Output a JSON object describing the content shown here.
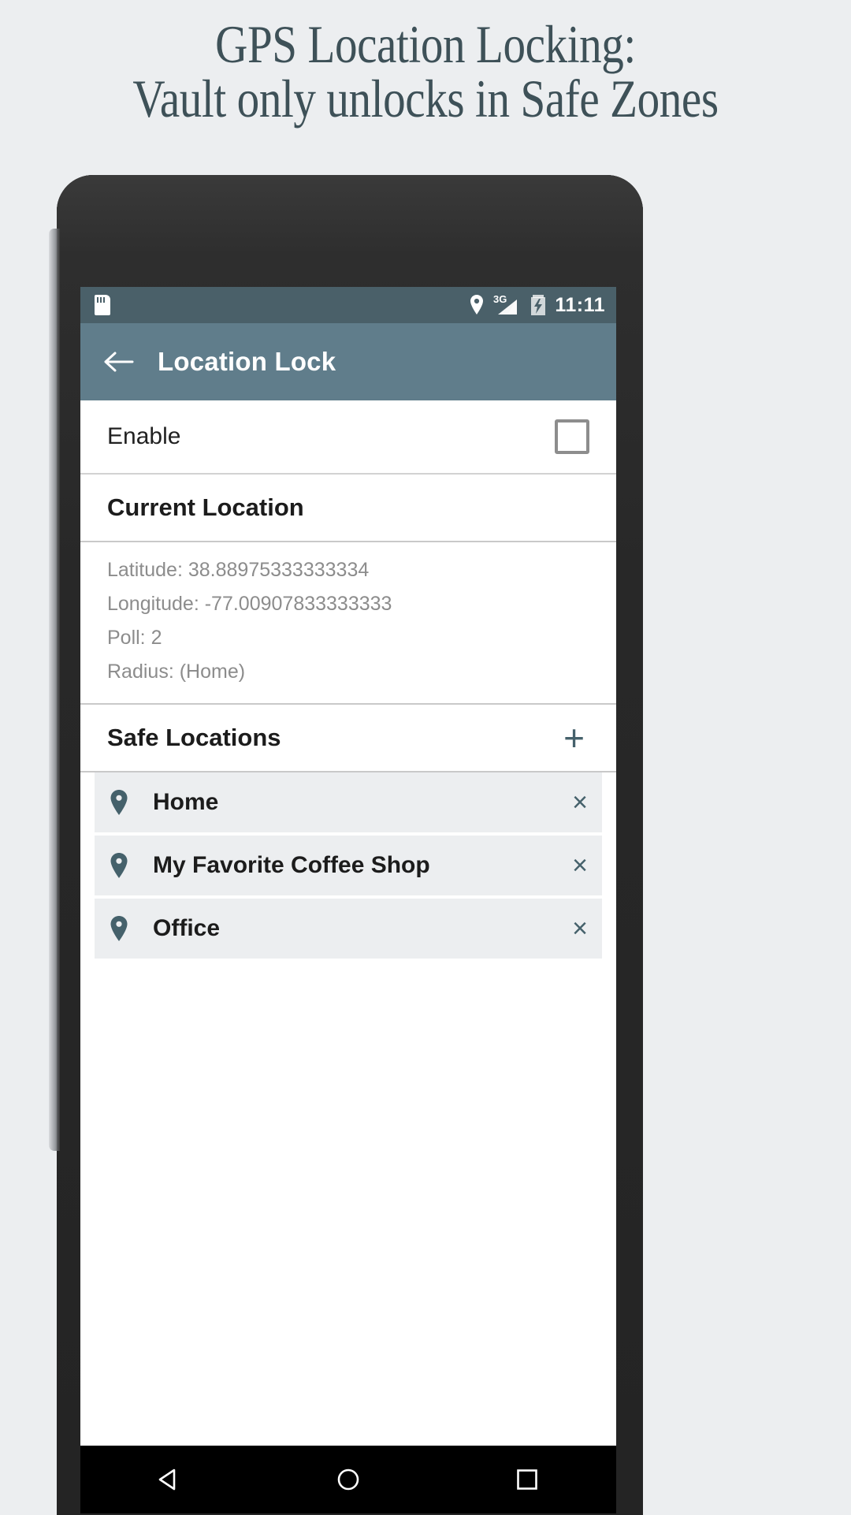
{
  "promo": {
    "line1": "GPS Location Locking:",
    "line2": "Vault only unlocks in Safe Zones",
    "color": "#3e5158"
  },
  "statusbar": {
    "sdcard_icon": "sd-card-icon",
    "location_icon": "location-pin-icon",
    "network_label": "3G",
    "battery_icon": "battery-charging-icon",
    "time": "11:11",
    "background": "#4a6069"
  },
  "appbar": {
    "back_icon": "back-arrow-icon",
    "title": "Location Lock",
    "background": "#607d8b"
  },
  "enable_row": {
    "label": "Enable",
    "checked": false
  },
  "current_location": {
    "title": "Current Location",
    "fields": [
      "Latitude: 38.88975333333334",
      "Longitude: -77.00907833333333",
      "Poll: 2",
      "Radius: (Home)"
    ]
  },
  "safe_locations": {
    "title": "Safe Locations",
    "add_label": "+",
    "items": [
      {
        "name": "Home",
        "pin_icon": "map-pin-icon",
        "delete_label": "×"
      },
      {
        "name": "My Favorite Coffee Shop",
        "pin_icon": "map-pin-icon",
        "delete_label": "×"
      },
      {
        "name": "Office",
        "pin_icon": "map-pin-icon",
        "delete_label": "×"
      }
    ]
  },
  "navbar": {
    "back_icon": "nav-back-triangle-icon",
    "home_icon": "nav-home-circle-icon",
    "recents_icon": "nav-recents-square-icon"
  },
  "accent": "#45616b"
}
